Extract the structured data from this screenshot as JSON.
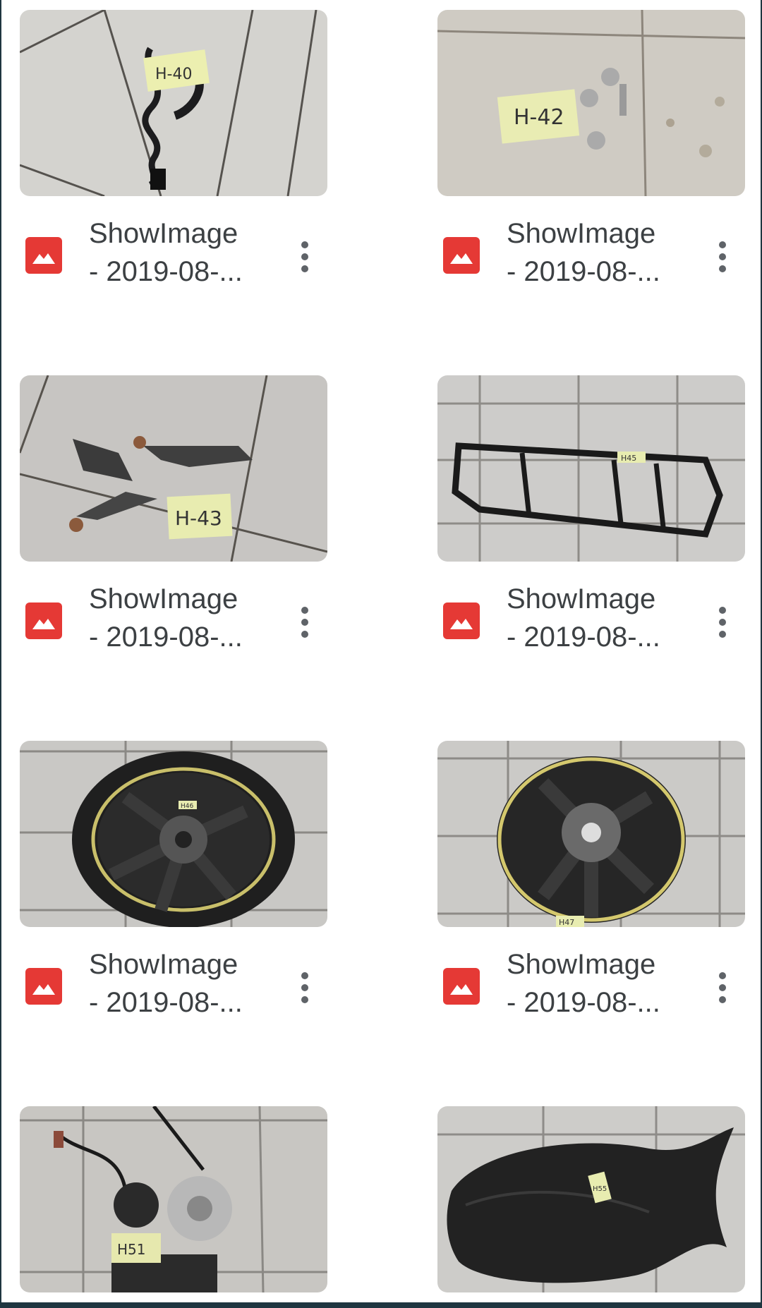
{
  "files": [
    {
      "name_line1": "ShowImage",
      "name_line2": "- 2019-08-...",
      "tag": "H-40",
      "thumb": "wire-harness",
      "icon": "image-file-icon"
    },
    {
      "name_line1": "ShowImage",
      "name_line2": "- 2019-08-...",
      "tag": "H-42",
      "thumb": "bolts",
      "icon": "image-file-icon"
    },
    {
      "name_line1": "ShowImage",
      "name_line2": "- 2019-08-...",
      "tag": "H-43",
      "thumb": "brake-pads",
      "icon": "image-file-icon"
    },
    {
      "name_line1": "ShowImage",
      "name_line2": "- 2019-08-...",
      "tag": "H45",
      "thumb": "subframe",
      "icon": "image-file-icon"
    },
    {
      "name_line1": "ShowImage",
      "name_line2": "- 2019-08-...",
      "tag": "H46",
      "thumb": "front-wheel",
      "icon": "image-file-icon"
    },
    {
      "name_line1": "ShowImage",
      "name_line2": "- 2019-08-...",
      "tag": "H47",
      "thumb": "rear-wheel",
      "icon": "image-file-icon"
    },
    {
      "name_line1": "",
      "name_line2": "",
      "tag": "H51",
      "thumb": "ignition-lock-set",
      "icon": ""
    },
    {
      "name_line1": "",
      "name_line2": "",
      "tag": "H55",
      "thumb": "seat",
      "icon": ""
    }
  ],
  "colors": {
    "file_icon": "#e53935",
    "background_edge": "#1f3640",
    "text": "#3c4043"
  }
}
